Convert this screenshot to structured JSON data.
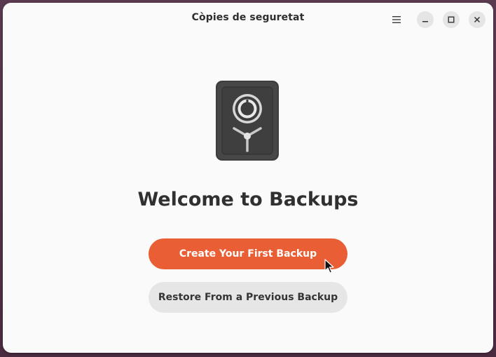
{
  "window": {
    "title": "Còpies de seguretat"
  },
  "headerbar": {
    "menu_icon": "hamburger-menu-icon",
    "minimize_icon": "minimize-icon",
    "maximize_icon": "maximize-icon",
    "close_icon": "close-icon"
  },
  "main": {
    "illustration": "safe-vault-icon",
    "heading": "Welcome to Backups",
    "primary_button_label": "Create Your First Backup",
    "secondary_button_label": "Restore From a Previous Backup"
  },
  "colors": {
    "accent": "#e95e34",
    "window_bg": "#fafafa",
    "secondary_button_bg": "#e6e6e6",
    "desktop_bg": "#4f3045"
  }
}
